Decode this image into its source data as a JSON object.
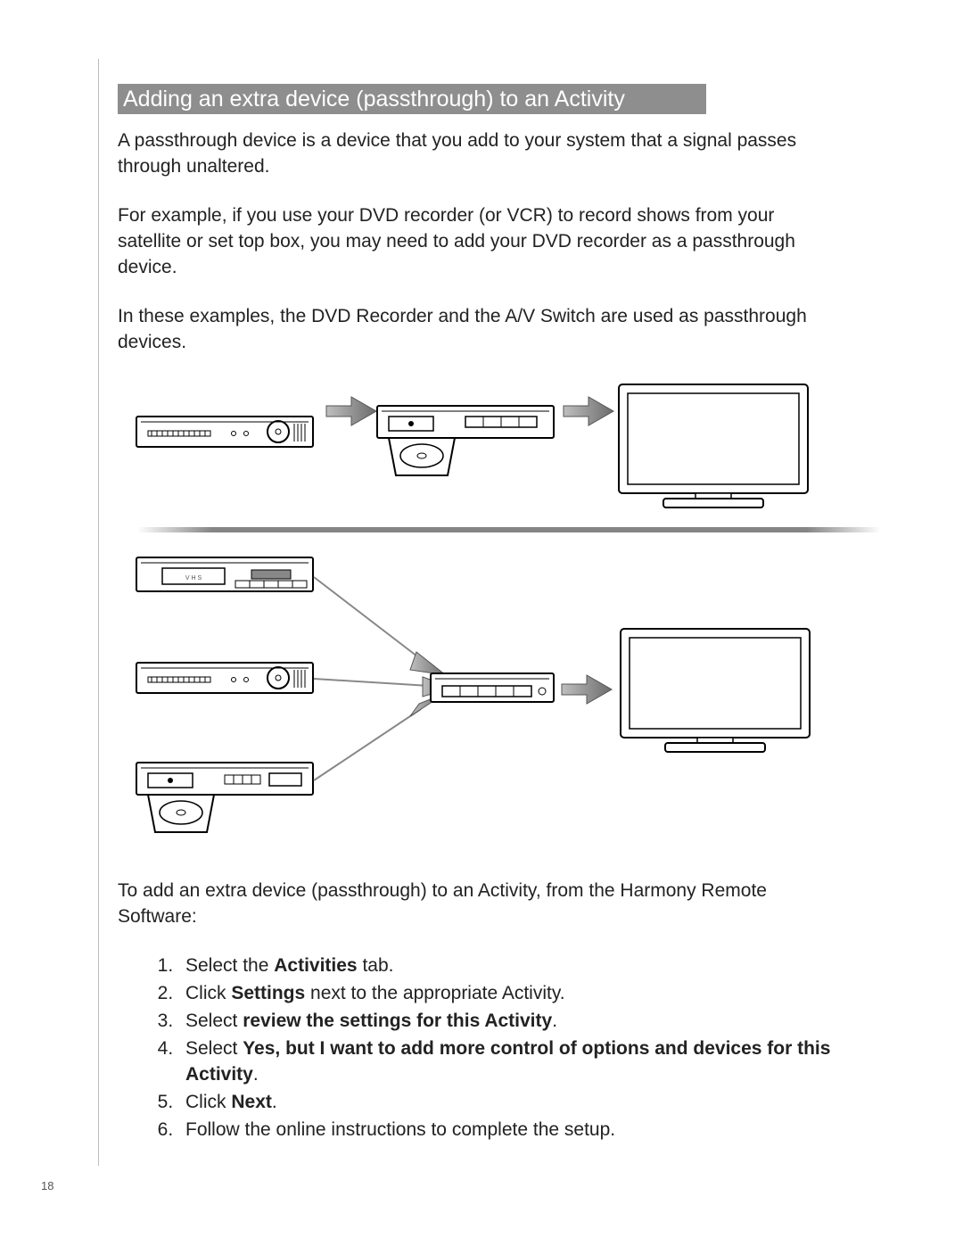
{
  "heading": "Adding an extra device (passthrough) to an Activity",
  "para1": "A passthrough device is a device that you add to your system that a signal passes through unaltered.",
  "para2": "For example,  if you use your DVD recorder (or VCR) to record shows from your satellite or set top box, you may need to add your DVD recorder as a passthrough device.",
  "para3": "In these examples, the DVD Recorder and the A/V Switch are used as passthrough devices.",
  "para4": "To add an extra device (passthrough) to an Activity, from the Harmony Remote Software:",
  "steps": {
    "s1a": "Select the ",
    "s1b": "Activities",
    "s1c": " tab.",
    "s2a": "Click ",
    "s2b": "Settings",
    "s2c": " next to the appropriate Activity.",
    "s3a": "Select ",
    "s3b": "review the settings for this Activity",
    "s3c": ".",
    "s4a": "Select ",
    "s4b": "Yes, but I want to add more control of options and devices for this Activity",
    "s4c": ".",
    "s5a": "Click ",
    "s5b": "Next",
    "s5c": ".",
    "s6": "Follow the online instructions to complete the setup."
  },
  "diagram": {
    "row1": [
      "receiver",
      "dvd-recorder",
      "tv"
    ],
    "row2_sources": [
      "vcr",
      "receiver",
      "dvd-player"
    ],
    "row2_switch": "av-switch",
    "row2_sink": "tv",
    "vhs_label": "V H S"
  },
  "page_number": "18"
}
